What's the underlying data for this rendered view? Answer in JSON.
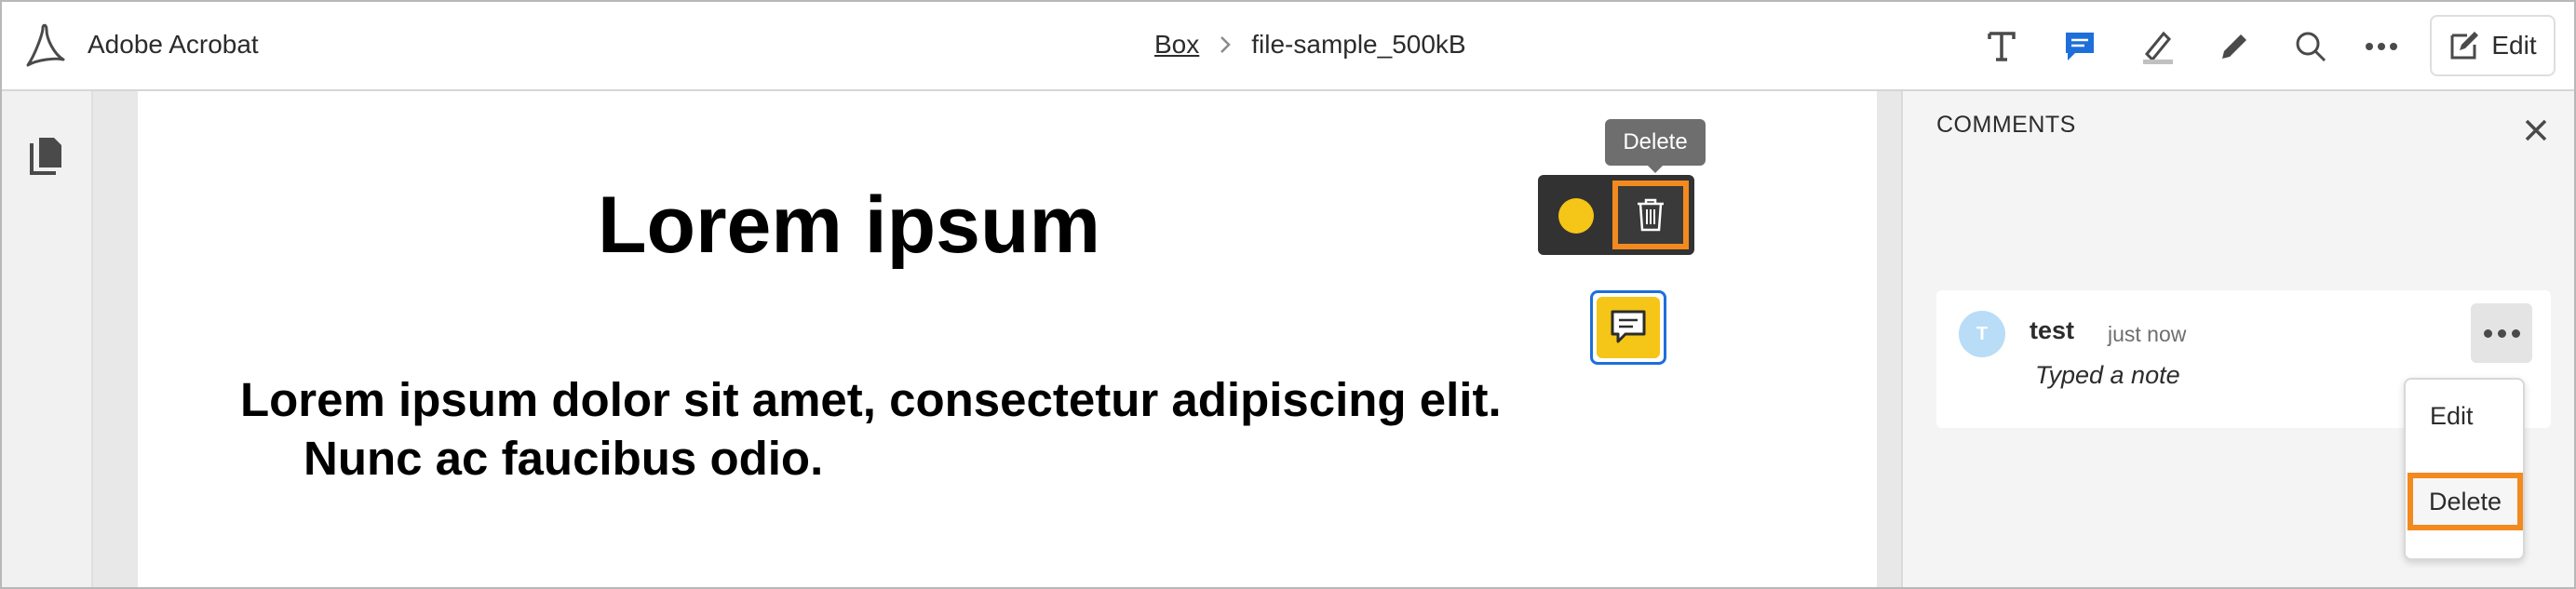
{
  "app": {
    "title": "Adobe Acrobat"
  },
  "breadcrumb": {
    "parent": "Box",
    "current": "file-sample_500kB"
  },
  "toolbar": {
    "tools": [
      "text-tool-icon",
      "comment-tool-icon",
      "highlight-tool-icon",
      "pencil-tool-icon",
      "search-icon",
      "more-icon"
    ],
    "edit_label": "Edit",
    "active_color": "#1e6fd9"
  },
  "document": {
    "title": "Lorem ipsum",
    "body_line1": "Lorem ipsum dolor sit amet, consectetur adipiscing elit.",
    "body_line2": "Nunc ac faucibus odio."
  },
  "annotation_toolbar": {
    "tooltip": "Delete",
    "note_color": "#f5c518",
    "highlight_color": "#f28a1f"
  },
  "comments_panel": {
    "title": "COMMENTS",
    "comment": {
      "avatar_initial": "T",
      "author": "test",
      "time": "just now",
      "text": "Typed a note"
    },
    "menu": {
      "edit": "Edit",
      "delete": "Delete"
    }
  }
}
